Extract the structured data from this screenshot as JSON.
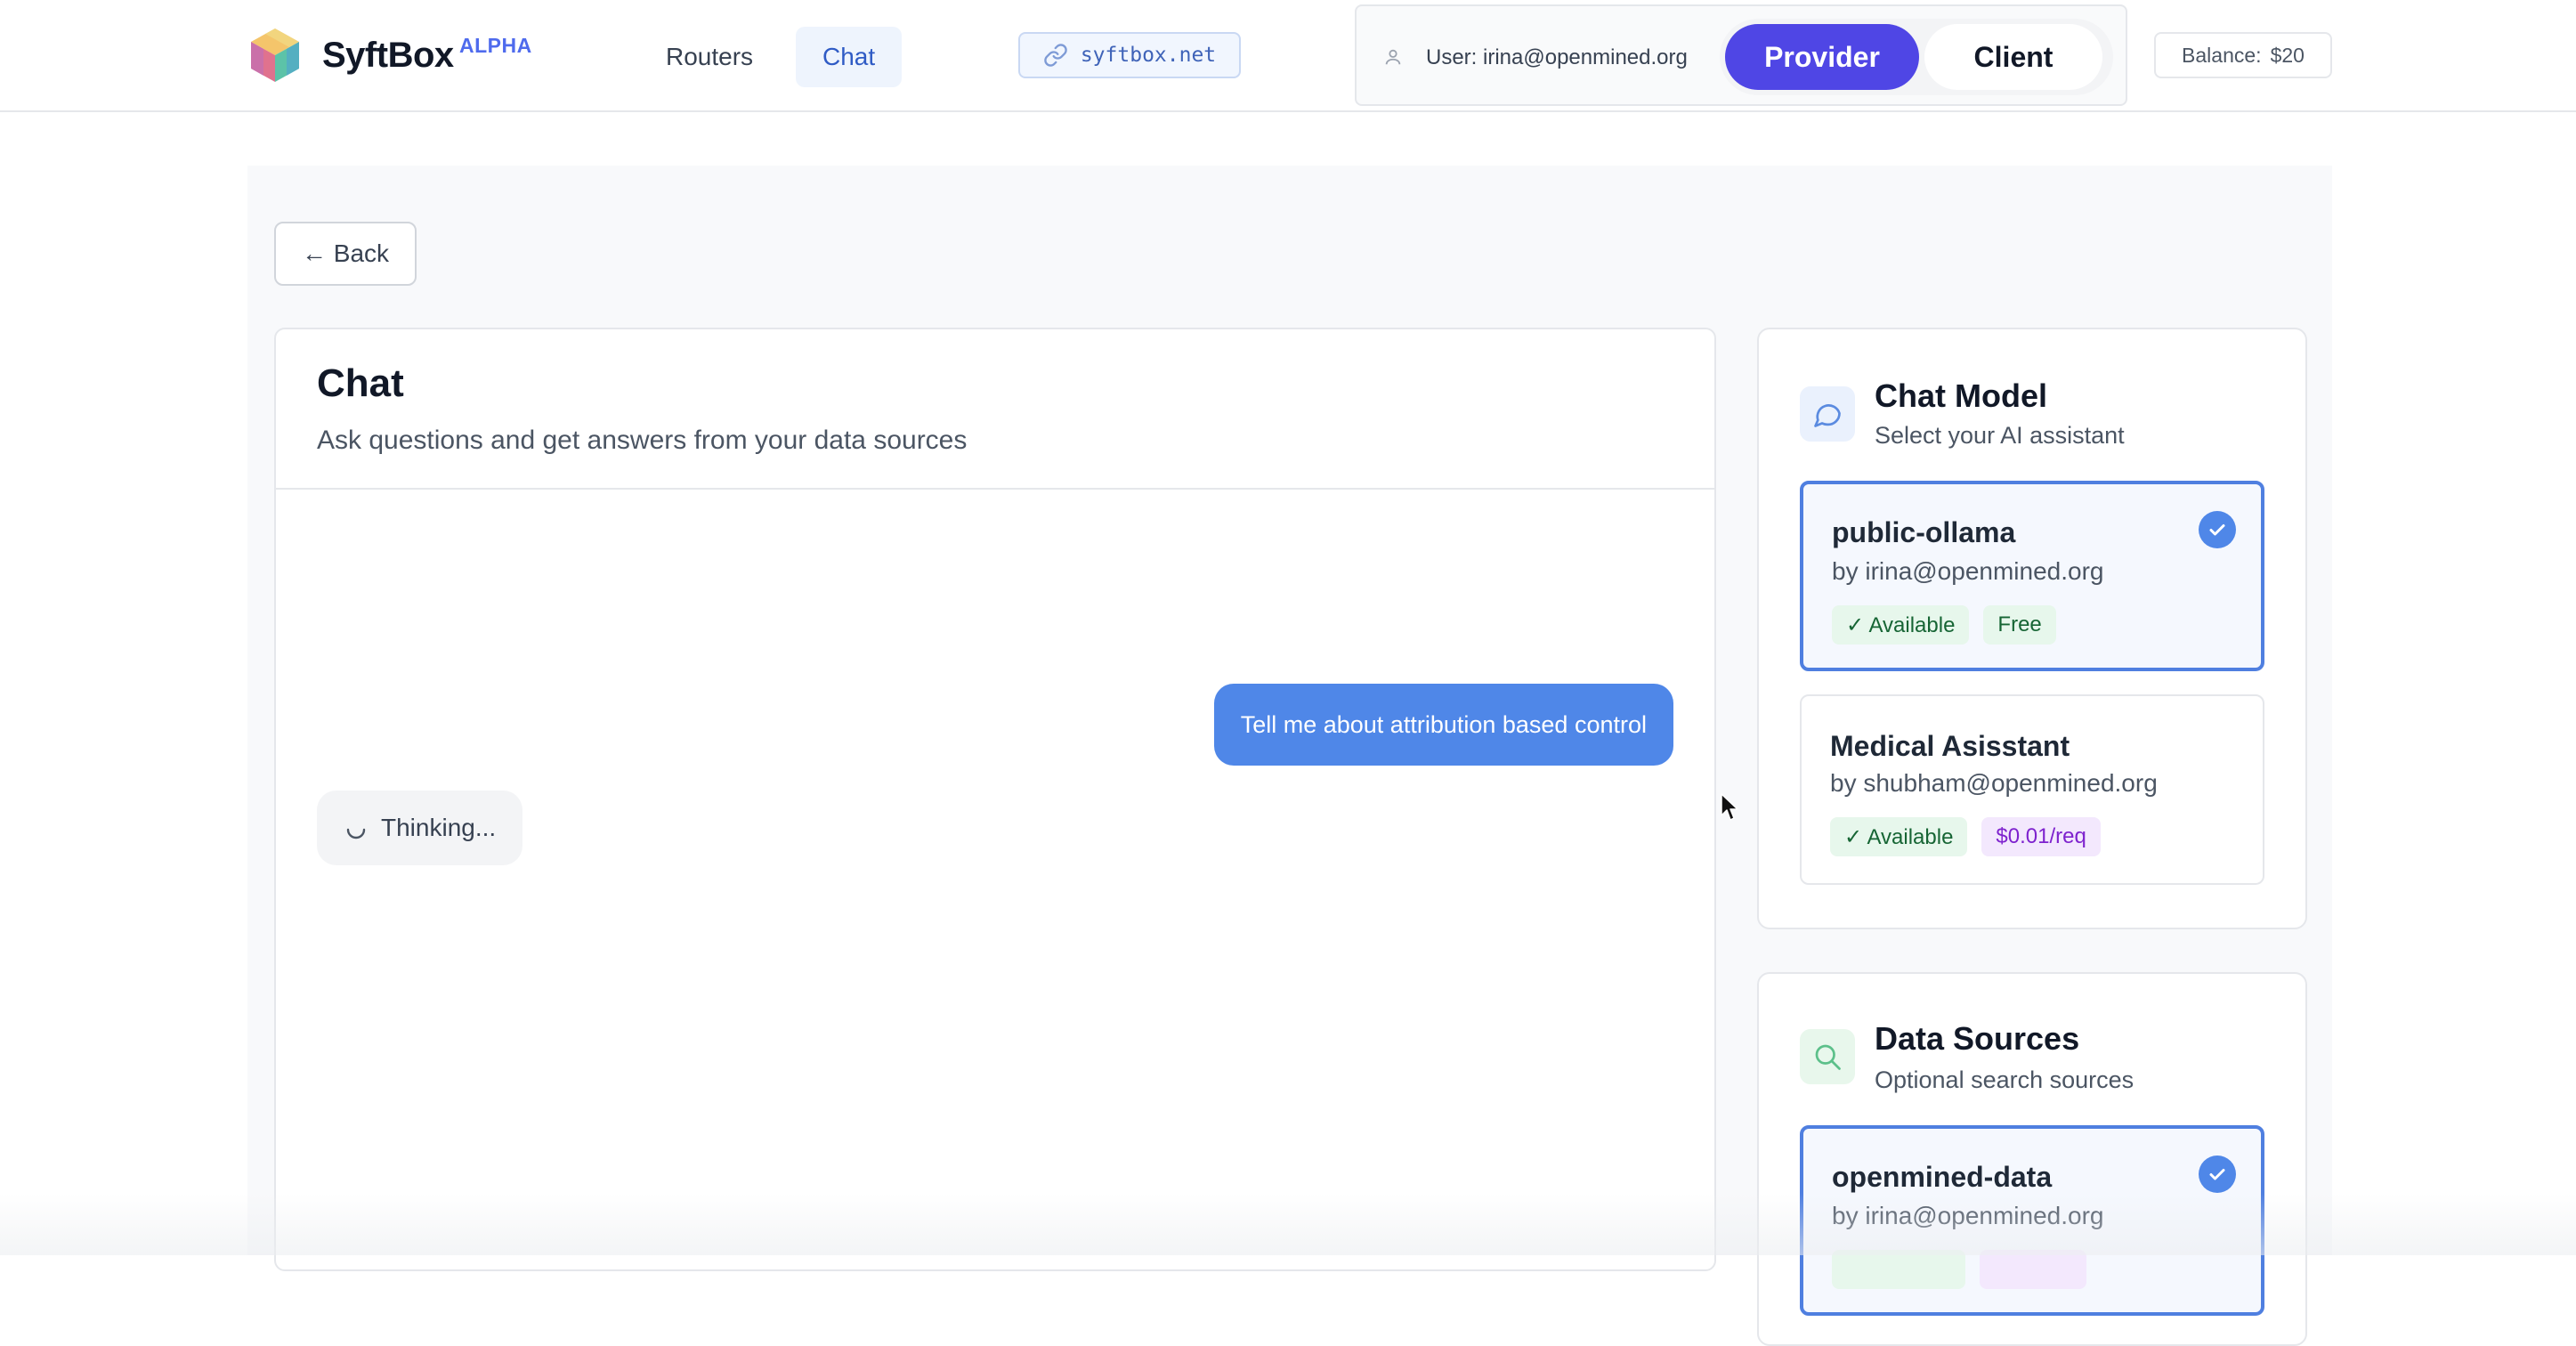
{
  "header": {
    "brand": "SyftBox",
    "badge": "ALPHA",
    "nav": [
      {
        "label": "Routers",
        "active": false
      },
      {
        "label": "Chat",
        "active": true
      }
    ],
    "domain": "syftbox.net",
    "user_label": "User: irina@openmined.org",
    "roles": {
      "provider": "Provider",
      "client": "Client",
      "active": "Provider"
    },
    "balance_label": "Balance:",
    "balance_value": "$20"
  },
  "page": {
    "back_label": "← Back"
  },
  "chat": {
    "title": "Chat",
    "subtitle": "Ask questions and get answers from your data sources",
    "messages": [
      {
        "role": "user",
        "text": "Tell me about attribution based control"
      },
      {
        "role": "assistant",
        "status": "loading",
        "text": "Thinking..."
      }
    ]
  },
  "chat_model": {
    "title": "Chat Model",
    "subtitle": "Select your AI assistant",
    "options": [
      {
        "name": "public-ollama",
        "by": "by irina@openmined.org",
        "selected": true,
        "status": "✓ Available",
        "price": "Free"
      },
      {
        "name": "Medical Asisstant",
        "by": "by shubham@openmined.org",
        "selected": false,
        "status": "✓ Available",
        "price": "$0.01/req"
      }
    ]
  },
  "data_sources": {
    "title": "Data Sources",
    "subtitle": "Optional search sources",
    "options": [
      {
        "name": "openmined-data",
        "by": "by irina@openmined.org",
        "selected": true
      }
    ]
  },
  "colors": {
    "accent": "#4f46e5",
    "link": "#2f5bc5",
    "user_bubble": "#4f87e8",
    "selected_border": "#4f7fe0"
  }
}
